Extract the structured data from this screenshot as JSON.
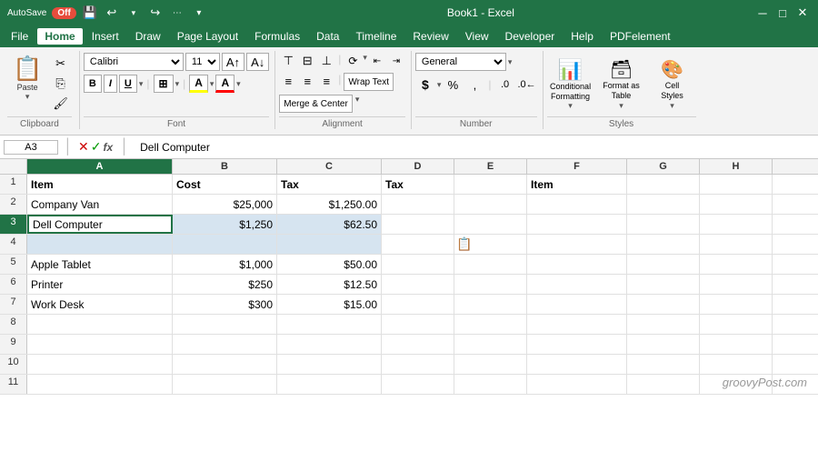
{
  "titlebar": {
    "autosave": "AutoSave",
    "autosave_state": "Off",
    "title": "Book1 - Excel",
    "save_icon": "💾",
    "undo_icon": "↩",
    "redo_icon": "↪"
  },
  "menubar": {
    "items": [
      "File",
      "Home",
      "Insert",
      "Draw",
      "Page Layout",
      "Formulas",
      "Data",
      "Timeline",
      "Review",
      "View",
      "Developer",
      "Help",
      "PDFelement"
    ],
    "active": "Home"
  },
  "ribbon": {
    "clipboard": {
      "label": "Clipboard",
      "paste_label": "Paste"
    },
    "font": {
      "label": "Font",
      "font_name": "Calibri",
      "font_size": "11",
      "bold": "B",
      "italic": "I",
      "underline": "U",
      "format_more": "..."
    },
    "alignment": {
      "label": "Alignment",
      "wrap_text": "Wrap Text",
      "merge_center": "Merge & Center"
    },
    "number": {
      "label": "Number",
      "format": "General"
    },
    "styles": {
      "label": "Styles",
      "conditional": "Conditional\nFormatting",
      "format_table": "Format as\nTable",
      "cell_styles": "Cell\nStyles"
    }
  },
  "formulabar": {
    "cell_ref": "A3",
    "formula": "Dell Computer"
  },
  "columns": {
    "headers": [
      "A",
      "B",
      "C",
      "D",
      "E",
      "F",
      "G",
      "H"
    ]
  },
  "rows": [
    {
      "num": "1",
      "cells": [
        {
          "col": "a",
          "value": "Item",
          "bold": true,
          "align": "left"
        },
        {
          "col": "b",
          "value": "Cost",
          "bold": true,
          "align": "left"
        },
        {
          "col": "c",
          "value": "Tax",
          "bold": true,
          "align": "left"
        },
        {
          "col": "d",
          "value": "Tax",
          "bold": true,
          "align": "left"
        },
        {
          "col": "e",
          "value": "",
          "bold": false,
          "align": "left"
        },
        {
          "col": "f",
          "value": "Item",
          "bold": true,
          "align": "left"
        },
        {
          "col": "g",
          "value": "",
          "bold": false,
          "align": "left"
        },
        {
          "col": "h",
          "value": "",
          "bold": false,
          "align": "left"
        }
      ]
    },
    {
      "num": "2",
      "cells": [
        {
          "col": "a",
          "value": "Company Van",
          "bold": false,
          "align": "left"
        },
        {
          "col": "b",
          "value": "$25,000",
          "bold": false,
          "align": "right"
        },
        {
          "col": "c",
          "value": "$1,250.00",
          "bold": false,
          "align": "right"
        },
        {
          "col": "d",
          "value": "",
          "bold": false,
          "align": "left"
        },
        {
          "col": "e",
          "value": "",
          "bold": false,
          "align": "left"
        },
        {
          "col": "f",
          "value": "",
          "bold": false,
          "align": "left"
        },
        {
          "col": "g",
          "value": "",
          "bold": false,
          "align": "left"
        },
        {
          "col": "h",
          "value": "",
          "bold": false,
          "align": "left"
        }
      ]
    },
    {
      "num": "3",
      "cells": [
        {
          "col": "a",
          "value": "Dell Computer",
          "bold": false,
          "align": "left",
          "active": true
        },
        {
          "col": "b",
          "value": "$1,250",
          "bold": false,
          "align": "right",
          "selected": true
        },
        {
          "col": "c",
          "value": "$62.50",
          "bold": false,
          "align": "right",
          "selected": true
        },
        {
          "col": "d",
          "value": "",
          "bold": false,
          "align": "left"
        },
        {
          "col": "e",
          "value": "",
          "bold": false,
          "align": "left"
        },
        {
          "col": "f",
          "value": "",
          "bold": false,
          "align": "left"
        },
        {
          "col": "g",
          "value": "",
          "bold": false,
          "align": "left"
        },
        {
          "col": "h",
          "value": "",
          "bold": false,
          "align": "left"
        }
      ]
    },
    {
      "num": "4",
      "cells": [
        {
          "col": "a",
          "value": "",
          "selected": true
        },
        {
          "col": "b",
          "value": "",
          "selected": true
        },
        {
          "col": "c",
          "value": "",
          "selected": true
        },
        {
          "col": "d",
          "value": ""
        },
        {
          "col": "e",
          "value": ""
        },
        {
          "col": "f",
          "value": ""
        },
        {
          "col": "g",
          "value": ""
        },
        {
          "col": "h",
          "value": ""
        }
      ]
    },
    {
      "num": "5",
      "cells": [
        {
          "col": "a",
          "value": "Apple Tablet",
          "bold": false,
          "align": "left"
        },
        {
          "col": "b",
          "value": "$1,000",
          "bold": false,
          "align": "right"
        },
        {
          "col": "c",
          "value": "$50.00",
          "bold": false,
          "align": "right"
        },
        {
          "col": "d",
          "value": "",
          "bold": false,
          "align": "left"
        },
        {
          "col": "e",
          "value": "",
          "bold": false,
          "align": "left"
        },
        {
          "col": "f",
          "value": "",
          "bold": false,
          "align": "left"
        },
        {
          "col": "g",
          "value": "",
          "bold": false,
          "align": "left"
        },
        {
          "col": "h",
          "value": "",
          "bold": false,
          "align": "left"
        }
      ]
    },
    {
      "num": "6",
      "cells": [
        {
          "col": "a",
          "value": "Printer",
          "bold": false,
          "align": "left"
        },
        {
          "col": "b",
          "value": "$250",
          "bold": false,
          "align": "right"
        },
        {
          "col": "c",
          "value": "$12.50",
          "bold": false,
          "align": "right"
        },
        {
          "col": "d",
          "value": "",
          "bold": false,
          "align": "left"
        },
        {
          "col": "e",
          "value": "",
          "bold": false,
          "align": "left"
        },
        {
          "col": "f",
          "value": "",
          "bold": false,
          "align": "left"
        },
        {
          "col": "g",
          "value": "",
          "bold": false,
          "align": "left"
        },
        {
          "col": "h",
          "value": "",
          "bold": false,
          "align": "left"
        }
      ]
    },
    {
      "num": "7",
      "cells": [
        {
          "col": "a",
          "value": "Work Desk",
          "bold": false,
          "align": "left"
        },
        {
          "col": "b",
          "value": "$300",
          "bold": false,
          "align": "right"
        },
        {
          "col": "c",
          "value": "$15.00",
          "bold": false,
          "align": "right"
        },
        {
          "col": "d",
          "value": "",
          "bold": false,
          "align": "left"
        },
        {
          "col": "e",
          "value": "",
          "bold": false,
          "align": "left"
        },
        {
          "col": "f",
          "value": "",
          "bold": false,
          "align": "left"
        },
        {
          "col": "g",
          "value": "",
          "bold": false,
          "align": "left"
        },
        {
          "col": "h",
          "value": "",
          "bold": false,
          "align": "left"
        }
      ]
    },
    {
      "num": "8",
      "cells": [
        {
          "col": "a",
          "value": ""
        },
        {
          "col": "b",
          "value": ""
        },
        {
          "col": "c",
          "value": ""
        },
        {
          "col": "d",
          "value": ""
        },
        {
          "col": "e",
          "value": ""
        },
        {
          "col": "f",
          "value": ""
        },
        {
          "col": "g",
          "value": ""
        },
        {
          "col": "h",
          "value": ""
        }
      ]
    },
    {
      "num": "9",
      "cells": [
        {
          "col": "a",
          "value": ""
        },
        {
          "col": "b",
          "value": ""
        },
        {
          "col": "c",
          "value": ""
        },
        {
          "col": "d",
          "value": ""
        },
        {
          "col": "e",
          "value": ""
        },
        {
          "col": "f",
          "value": ""
        },
        {
          "col": "g",
          "value": ""
        },
        {
          "col": "h",
          "value": ""
        }
      ]
    },
    {
      "num": "10",
      "cells": [
        {
          "col": "a",
          "value": ""
        },
        {
          "col": "b",
          "value": ""
        },
        {
          "col": "c",
          "value": ""
        },
        {
          "col": "d",
          "value": ""
        },
        {
          "col": "e",
          "value": ""
        },
        {
          "col": "f",
          "value": ""
        },
        {
          "col": "g",
          "value": ""
        },
        {
          "col": "h",
          "value": ""
        }
      ]
    },
    {
      "num": "11",
      "cells": [
        {
          "col": "a",
          "value": ""
        },
        {
          "col": "b",
          "value": ""
        },
        {
          "col": "c",
          "value": ""
        },
        {
          "col": "d",
          "value": ""
        },
        {
          "col": "e",
          "value": ""
        },
        {
          "col": "f",
          "value": ""
        },
        {
          "col": "g",
          "value": ""
        },
        {
          "col": "h",
          "value": ""
        }
      ]
    }
  ],
  "watermark": "groovyPost.com"
}
